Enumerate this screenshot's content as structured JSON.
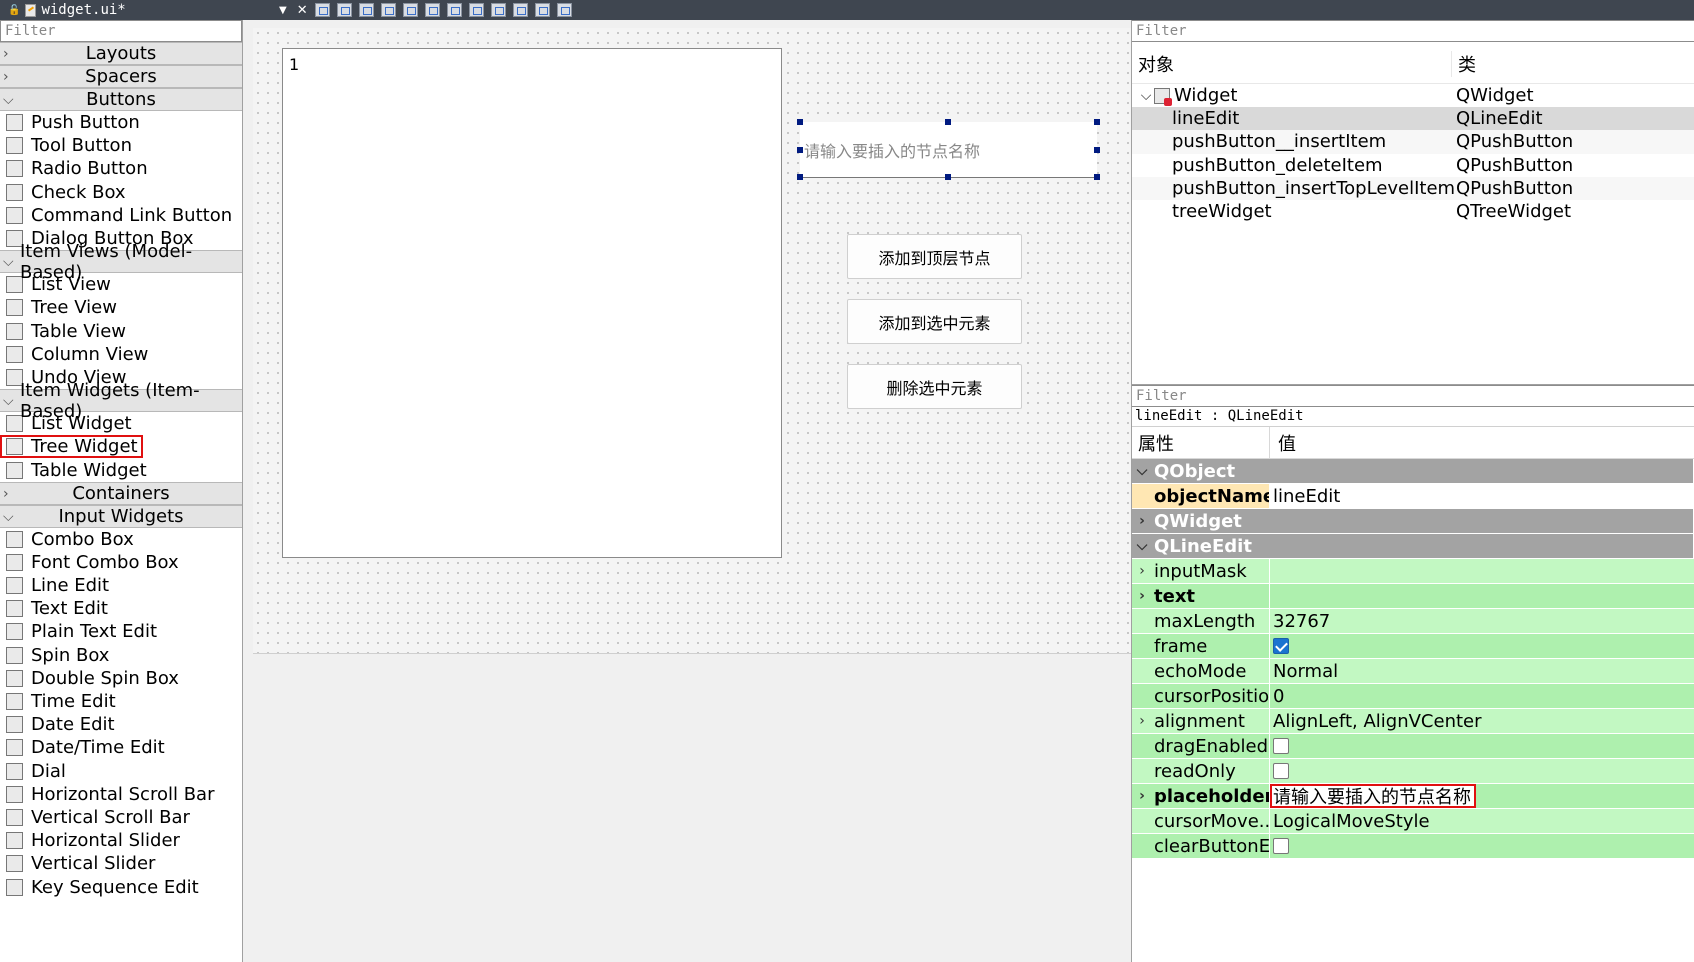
{
  "window": {
    "file_title": "widget.ui*"
  },
  "widgetbox": {
    "filter_placeholder": "Filter",
    "sections": [
      {
        "type": "cat",
        "label": "Layouts",
        "expanded": false
      },
      {
        "type": "cat",
        "label": "Spacers",
        "expanded": false
      },
      {
        "type": "cat",
        "label": "Buttons",
        "expanded": true
      },
      {
        "type": "item",
        "label": "Push Button",
        "icon": "push-button-icon"
      },
      {
        "type": "item",
        "label": "Tool Button",
        "icon": "tool-button-icon"
      },
      {
        "type": "item",
        "label": "Radio Button",
        "icon": "radio-button-icon"
      },
      {
        "type": "item",
        "label": "Check Box",
        "icon": "check-box-icon"
      },
      {
        "type": "item",
        "label": "Command Link Button",
        "icon": "command-link-icon"
      },
      {
        "type": "item",
        "label": "Dialog Button Box",
        "icon": "dialog-button-box-icon"
      },
      {
        "type": "cat",
        "label": "Item Views (Model-Based)",
        "expanded": true
      },
      {
        "type": "item",
        "label": "List View",
        "icon": "list-view-icon"
      },
      {
        "type": "item",
        "label": "Tree View",
        "icon": "tree-view-icon"
      },
      {
        "type": "item",
        "label": "Table View",
        "icon": "table-view-icon"
      },
      {
        "type": "item",
        "label": "Column View",
        "icon": "column-view-icon"
      },
      {
        "type": "item",
        "label": "Undo View",
        "icon": "undo-view-icon"
      },
      {
        "type": "cat",
        "label": "Item Widgets (Item-Based)",
        "expanded": true
      },
      {
        "type": "item",
        "label": "List Widget",
        "icon": "list-widget-icon"
      },
      {
        "type": "item",
        "label": "Tree Widget",
        "icon": "tree-widget-icon",
        "highlighted": true
      },
      {
        "type": "item",
        "label": "Table Widget",
        "icon": "table-widget-icon"
      },
      {
        "type": "cat",
        "label": "Containers",
        "expanded": false
      },
      {
        "type": "cat",
        "label": "Input Widgets",
        "expanded": true
      },
      {
        "type": "item",
        "label": "Combo Box",
        "icon": "combo-box-icon"
      },
      {
        "type": "item",
        "label": "Font Combo Box",
        "icon": "font-combo-box-icon"
      },
      {
        "type": "item",
        "label": "Line Edit",
        "icon": "line-edit-icon"
      },
      {
        "type": "item",
        "label": "Text Edit",
        "icon": "text-edit-icon"
      },
      {
        "type": "item",
        "label": "Plain Text Edit",
        "icon": "plain-text-edit-icon"
      },
      {
        "type": "item",
        "label": "Spin Box",
        "icon": "spin-box-icon"
      },
      {
        "type": "item",
        "label": "Double Spin Box",
        "icon": "double-spin-box-icon"
      },
      {
        "type": "item",
        "label": "Time Edit",
        "icon": "time-edit-icon"
      },
      {
        "type": "item",
        "label": "Date Edit",
        "icon": "date-edit-icon"
      },
      {
        "type": "item",
        "label": "Date/Time Edit",
        "icon": "date-time-edit-icon"
      },
      {
        "type": "item",
        "label": "Dial",
        "icon": "dial-icon"
      },
      {
        "type": "item",
        "label": "Horizontal Scroll Bar",
        "icon": "horizontal-scroll-bar-icon"
      },
      {
        "type": "item",
        "label": "Vertical Scroll Bar",
        "icon": "vertical-scroll-bar-icon"
      },
      {
        "type": "item",
        "label": "Horizontal Slider",
        "icon": "horizontal-slider-icon"
      },
      {
        "type": "item",
        "label": "Vertical Slider",
        "icon": "vertical-slider-icon"
      },
      {
        "type": "item",
        "label": "Key Sequence Edit",
        "icon": "key-sequence-edit-icon"
      }
    ]
  },
  "form": {
    "tree_header": "1",
    "lineedit_placeholder": "请输入要插入的节点名称",
    "buttons": [
      "添加到顶层节点",
      "添加到选中元素",
      "删除选中元素"
    ]
  },
  "object_inspector": {
    "filter_placeholder": "Filter",
    "col_object": "对象",
    "col_class": "类",
    "rows": [
      {
        "name": "Widget",
        "cls": "QWidget",
        "root": true
      },
      {
        "name": "lineEdit",
        "cls": "QLineEdit",
        "selected": true
      },
      {
        "name": "pushButton__insertItem",
        "cls": "QPushButton"
      },
      {
        "name": "pushButton_deleteItem",
        "cls": "QPushButton"
      },
      {
        "name": "pushButton_insertTopLevelItem",
        "cls": "QPushButton"
      },
      {
        "name": "treeWidget",
        "cls": "QTreeWidget"
      }
    ]
  },
  "property_editor": {
    "filter_placeholder": "Filter",
    "class_line": "lineEdit : QLineEdit",
    "col_property": "属性",
    "col_value": "值",
    "rows": [
      {
        "kind": "group",
        "label": "QObject",
        "expanded": true
      },
      {
        "kind": "obj",
        "label": "objectName",
        "value": "lineEdit"
      },
      {
        "kind": "group",
        "label": "QWidget",
        "expanded": false
      },
      {
        "kind": "group",
        "label": "QLineEdit",
        "expanded": true
      },
      {
        "kind": "green",
        "label": "inputMask",
        "value": "",
        "expandable": true
      },
      {
        "kind": "green2",
        "label": "text",
        "value": "",
        "expandable": true,
        "bold": true
      },
      {
        "kind": "green",
        "label": "maxLength",
        "value": "32767"
      },
      {
        "kind": "green2",
        "label": "frame",
        "checkbox": true,
        "checked": true
      },
      {
        "kind": "green",
        "label": "echoMode",
        "value": "Normal"
      },
      {
        "kind": "green2",
        "label": "cursorPosition",
        "value": "0"
      },
      {
        "kind": "green",
        "label": "alignment",
        "value": "AlignLeft, AlignVCenter",
        "expandable": true
      },
      {
        "kind": "green2",
        "label": "dragEnabled",
        "checkbox": true,
        "checked": false
      },
      {
        "kind": "green",
        "label": "readOnly",
        "checkbox": true,
        "checked": false
      },
      {
        "kind": "green2",
        "label": "placeholder...",
        "value": "请输入要插入的节点名称",
        "expandable": true,
        "bold": true,
        "highlighted": true
      },
      {
        "kind": "green",
        "label": "cursorMove...",
        "value": "LogicalMoveStyle"
      },
      {
        "kind": "green2",
        "label": "clearButtonE...",
        "checkbox": true,
        "checked": false
      }
    ]
  },
  "colors": {
    "highlight_red": "#e01010",
    "property_green": "#c2f8c2",
    "group_gray": "#a3a3a3",
    "object_name_orange": "#ffe7b3"
  }
}
